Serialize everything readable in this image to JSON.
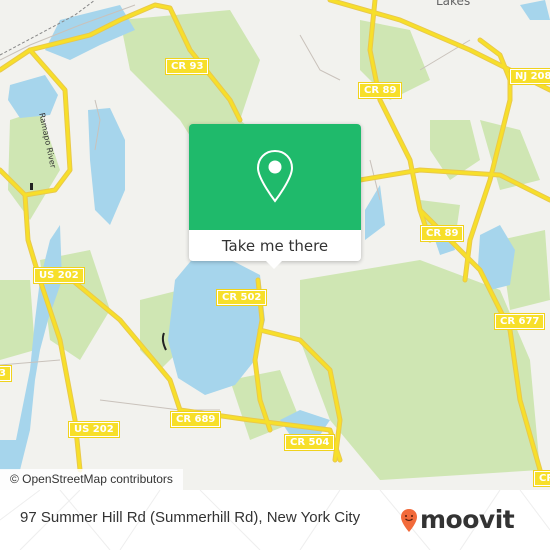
{
  "map": {
    "colors": {
      "background": "#f2f2ee",
      "water": "#a6d5ec",
      "park": "#cfe6b3",
      "road": "#f7df2a",
      "road_casing": "#e9c94a",
      "minor_road": "#c9c2bb"
    },
    "place_labels": [
      {
        "id": "lakes",
        "text": "Lakes"
      }
    ],
    "water_labels": [
      {
        "id": "ramapo-river",
        "text": "Ramapo River"
      }
    ],
    "road_shields": [
      {
        "id": "cr93",
        "text": "CR 93"
      },
      {
        "id": "cr89-north",
        "text": "CR 89"
      },
      {
        "id": "nj208",
        "text": "NJ 208"
      },
      {
        "id": "cr89-east",
        "text": "CR 89"
      },
      {
        "id": "us202-north",
        "text": "US 202"
      },
      {
        "id": "cr502",
        "text": "CR 502"
      },
      {
        "id": "cr677",
        "text": "CR 677"
      },
      {
        "id": "us202-south",
        "text": "US 202"
      },
      {
        "id": "cr689",
        "text": "CR 689"
      },
      {
        "id": "cr504",
        "text": "CR 504"
      },
      {
        "id": "partial-left",
        "text": "3"
      },
      {
        "id": "partial-bottom-right",
        "text": "CR"
      }
    ],
    "attribution": "© OpenStreetMap contributors"
  },
  "popup": {
    "icon": "location-pin-icon",
    "button_label": "Take me there",
    "accent_color": "#1fba6b"
  },
  "footer": {
    "address": "97 Summer Hill Rd (Summerhill Rd), New York City",
    "brand_name": "moovit",
    "brand_icon": "moovit-pin-logo-icon",
    "brand_color": "#f26a3a"
  }
}
